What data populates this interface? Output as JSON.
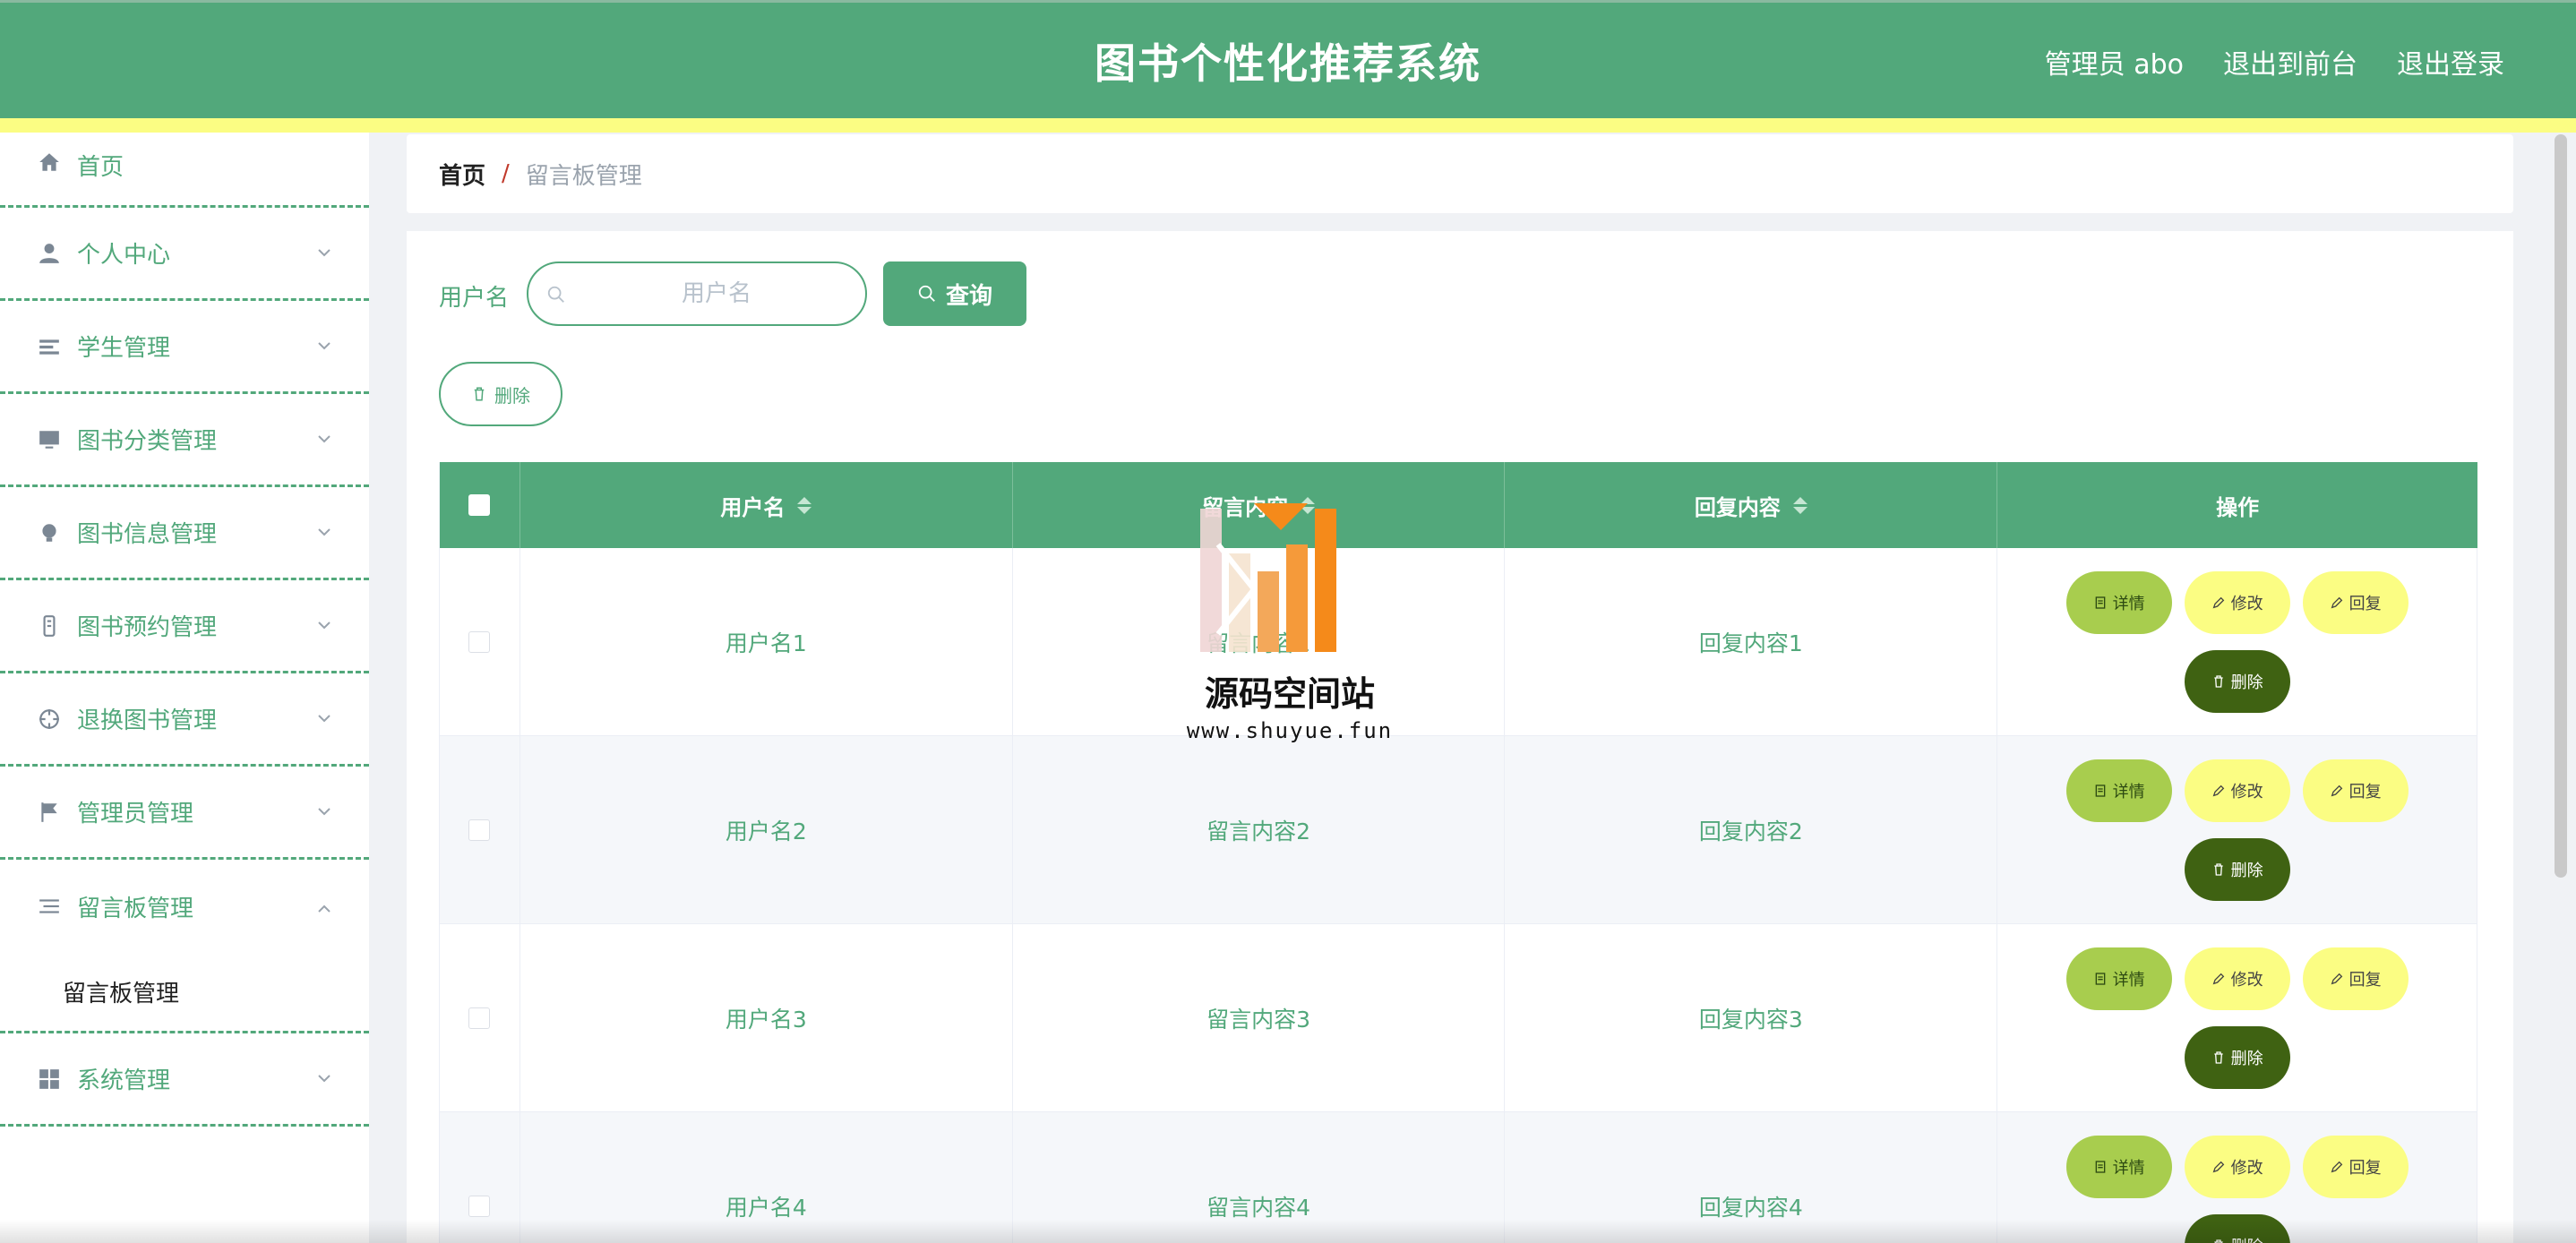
{
  "header": {
    "title": "图书个性化推荐系统",
    "admin_label": "管理员 abo",
    "frontend_link": "退出到前台",
    "logout_link": "退出登录"
  },
  "sidebar": {
    "items": [
      {
        "label": "首页",
        "icon": "home-icon"
      },
      {
        "label": "个人中心",
        "icon": "user-icon"
      },
      {
        "label": "学生管理",
        "icon": "list-icon"
      },
      {
        "label": "图书分类管理",
        "icon": "monitor-icon"
      },
      {
        "label": "图书信息管理",
        "icon": "bulb-icon"
      },
      {
        "label": "图书预约管理",
        "icon": "phone-icon"
      },
      {
        "label": "退换图书管理",
        "icon": "target-icon"
      },
      {
        "label": "管理员管理",
        "icon": "flag-icon"
      },
      {
        "label": "留言板管理",
        "icon": "menu-icon"
      },
      {
        "label": "系统管理",
        "icon": "grid-icon"
      }
    ],
    "submenu_label": "留言板管理"
  },
  "breadcrumb": {
    "home": "首页",
    "separator": "/",
    "current": "留言板管理"
  },
  "search": {
    "label": "用户名",
    "placeholder": "用户名",
    "value": "",
    "query_button": "查询"
  },
  "toolbar": {
    "delete_button": "删除"
  },
  "table": {
    "headers": {
      "username": "用户名",
      "content": "留言内容",
      "reply": "回复内容",
      "ops": "操作"
    },
    "rows": [
      {
        "username": "用户名1",
        "content": "留言内容1",
        "reply": "回复内容1"
      },
      {
        "username": "用户名2",
        "content": "留言内容2",
        "reply": "回复内容2"
      },
      {
        "username": "用户名3",
        "content": "留言内容3",
        "reply": "回复内容3"
      },
      {
        "username": "用户名4",
        "content": "留言内容4",
        "reply": "回复内容4"
      }
    ],
    "ops": {
      "detail": "详情",
      "edit": "修改",
      "reply": "回复",
      "delete": "删除"
    }
  },
  "watermark": {
    "text": "源码空间站",
    "url": "www.shuyue.fun"
  },
  "colors": {
    "primary": "#52a87b",
    "accent_yellow": "#fbfd83",
    "detail_green": "#a8cd4e",
    "delete_dark": "#3f6212"
  }
}
